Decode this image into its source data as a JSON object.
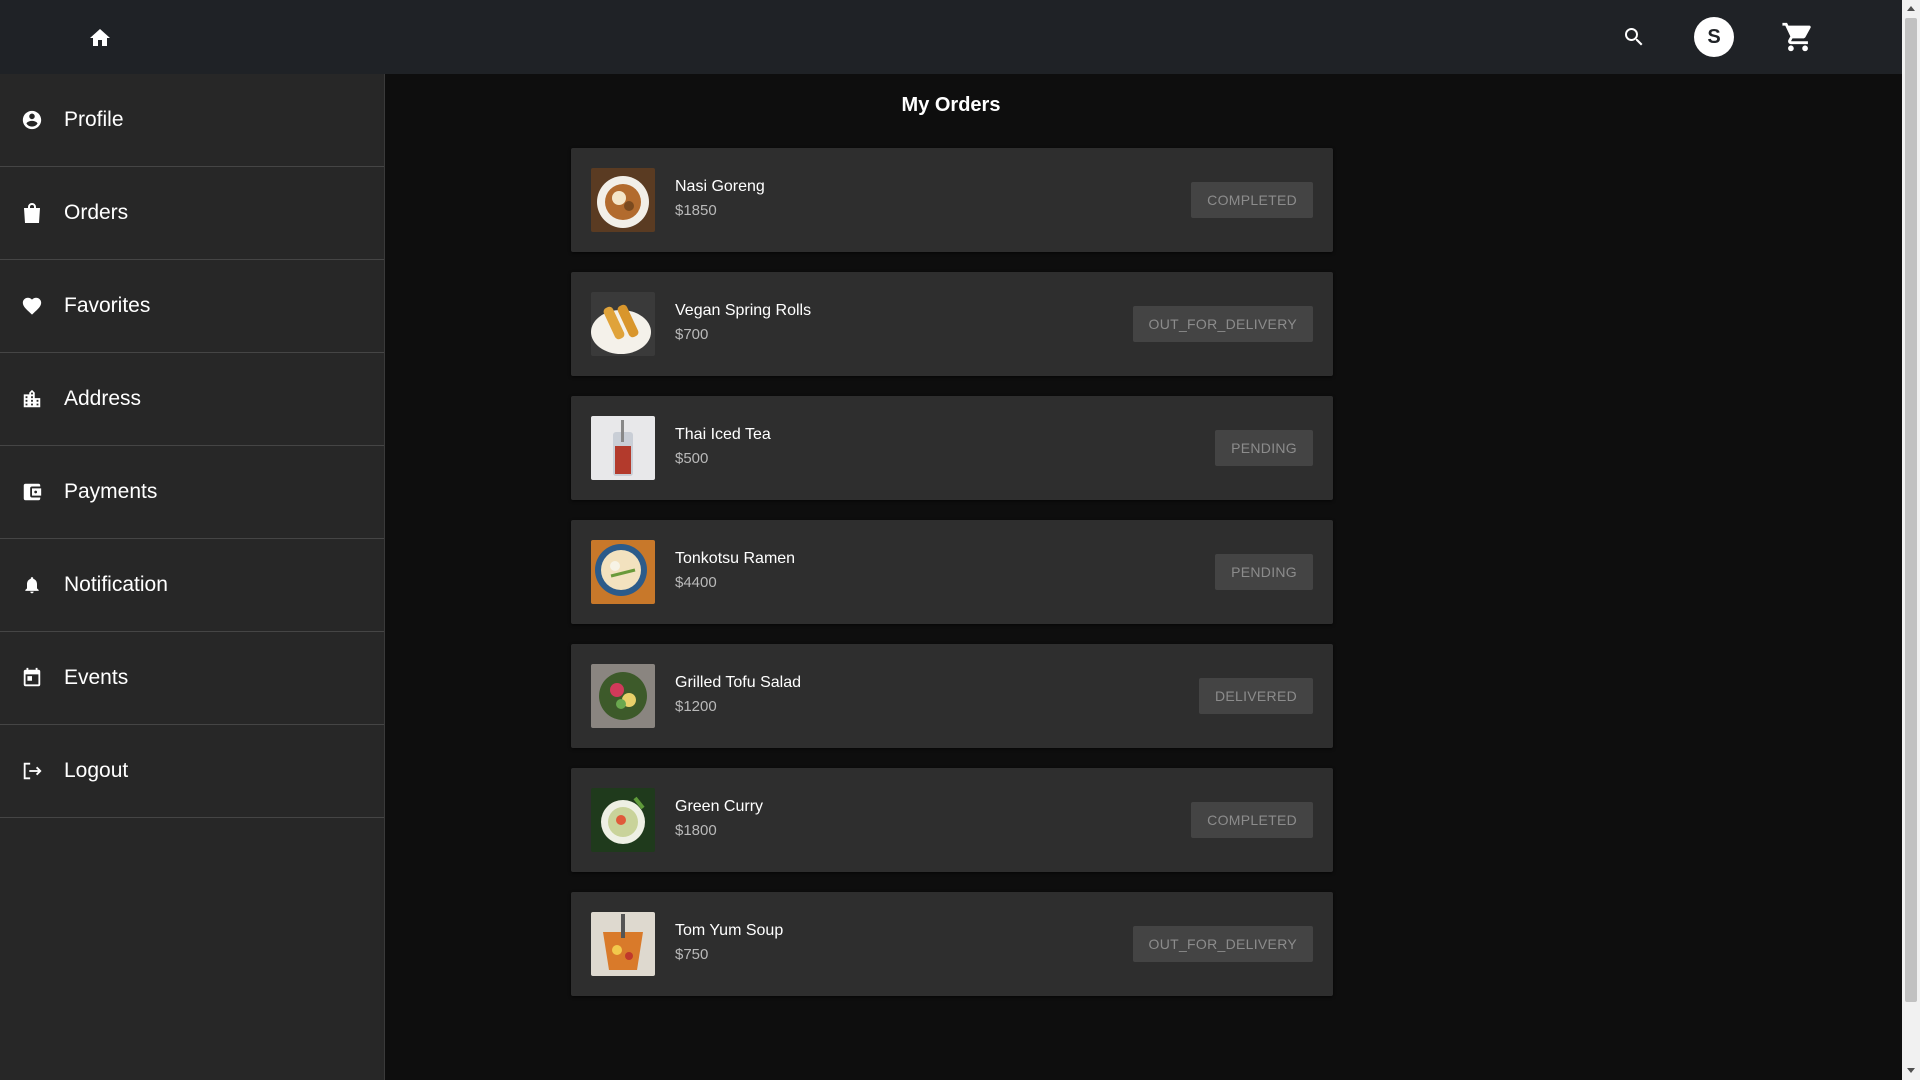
{
  "header": {
    "home_icon": "home-icon",
    "search_icon": "search-icon",
    "avatar_initial": "S",
    "cart_icon": "cart-icon"
  },
  "sidebar": {
    "items": [
      {
        "label": "Profile",
        "icon": "account-circle-icon"
      },
      {
        "label": "Orders",
        "icon": "shopping-bag-icon"
      },
      {
        "label": "Favorites",
        "icon": "heart-icon"
      },
      {
        "label": "Address",
        "icon": "location-city-icon"
      },
      {
        "label": "Payments",
        "icon": "wallet-icon"
      },
      {
        "label": "Notification",
        "icon": "bell-icon"
      },
      {
        "label": "Events",
        "icon": "calendar-icon"
      },
      {
        "label": "Logout",
        "icon": "logout-icon"
      }
    ]
  },
  "main": {
    "title": "My Orders",
    "orders": [
      {
        "name": "Nasi Goreng",
        "price": "$1850",
        "status": "COMPLETED"
      },
      {
        "name": "Vegan Spring Rolls",
        "price": "$700",
        "status": "OUT_FOR_DELIVERY"
      },
      {
        "name": "Thai Iced Tea",
        "price": "$500",
        "status": "PENDING"
      },
      {
        "name": "Tonkotsu Ramen",
        "price": "$4400",
        "status": "PENDING"
      },
      {
        "name": "Grilled Tofu Salad",
        "price": "$1200",
        "status": "DELIVERED"
      },
      {
        "name": "Green Curry",
        "price": "$1800",
        "status": "COMPLETED"
      },
      {
        "name": "Tom Yum Soup",
        "price": "$750",
        "status": "OUT_FOR_DELIVERY"
      }
    ]
  },
  "colors": {
    "topbar": "#1f2226",
    "sidebar": "#272727",
    "background": "#0e0e0e",
    "card": "#2e2e2e",
    "status_chip": "#444444"
  }
}
